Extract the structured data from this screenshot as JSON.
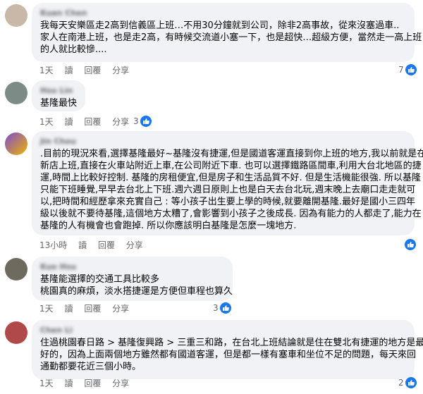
{
  "colors": {
    "bubble": "#f0f2f5",
    "meta": "#65676b",
    "like": "#1877f2"
  },
  "icons": {
    "like": "thumbs-up-icon"
  },
  "actions": {
    "read": "讀",
    "reply": "回覆",
    "share": "分享"
  },
  "comments": [
    {
      "author": "Kuan Chen",
      "lines": [
        "我每天安樂區走2高到信義區上班…不用30分鐘就到公司，除非2高事故，從來沒塞過車..",
        "家人在南港上班，也是走2高，有時候交流道小塞一下，也是超快…超級方便，當然走一高上班",
        "的人就比較慘...."
      ],
      "time": "1天",
      "reactions": "7"
    },
    {
      "author": "Hsu Lin",
      "lines": [
        "基隆最快"
      ],
      "time": "1天",
      "reactions": "3"
    },
    {
      "author": "Jin Chou",
      "lines": [
        ".目前的現況來看,選擇基隆最好~基隆沒有捷運,但是國道客運直接到你上班的地方,我以前就是在",
        "新店上班,直接在火車站附近上車,在公司附近下車. 也可以選擇鐵路區間車,利用大台北地區的捷",
        "運,時間上比較好控制. 基隆的房租便宜,但是房子和生活品質不好. 但是生活機能很強. 所以基隆",
        "只能下班睡覺,早早去台北上下班.週六週日原則上也是白天去台北玩,週末晚上去廟口走走就可",
        "以,把時間和經歷拿來充實自己 : 等小孩子出生要上學的時候,就要離開基隆.最好是國小三四年",
        "級以後就不要待基隆,這個地方太糟了,會影響到小孩子之後成長. 因為有能力的人都走了,能力在",
        "基隆的人有機會也會跑掉. 所以你應該明白基隆是怎麼一塊地方."
      ],
      "time": "13小時",
      "reactions": ""
    },
    {
      "author": "Kuo Hsu",
      "lines": [
        "基隆能選擇的交通工具比較多",
        "桃園真的麻煩，淡水搭捷運是方便但車程也算久"
      ],
      "time": "1天",
      "reactions": "3"
    },
    {
      "author": "Chen Li",
      "lines": [
        "住過桃園春日路 > 基隆復興路 > 三重三和路，在台北上班結論就是住在雙北有捷運的地方是最",
        "好的，因為上面兩個地方雖然都有國道客運，但是都一樣有塞車和坐位不足的問題，每天來回",
        "通勤都要花近三個小時。"
      ],
      "time": "1天",
      "reactions": "2"
    }
  ]
}
